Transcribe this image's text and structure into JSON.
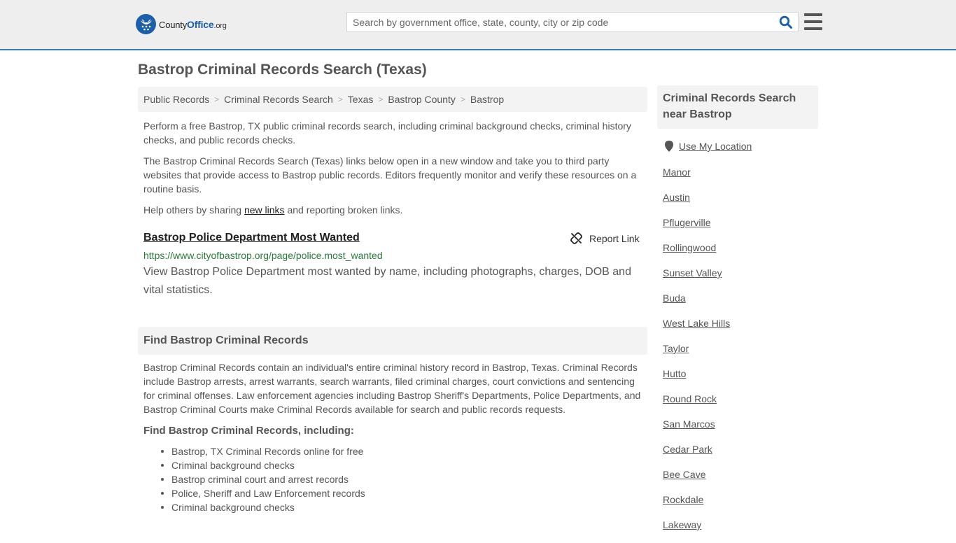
{
  "header": {
    "logo": {
      "brand_main": "County",
      "brand_accent": "Office",
      "brand_tld": ".org"
    },
    "search": {
      "placeholder": "Search by government office, state, county, city or zip code",
      "value": "",
      "icon": "search-icon"
    },
    "menu_icon": "hamburger-menu-icon"
  },
  "colors": {
    "brand_blue": "#1c5ea8",
    "header_border": "#3a7cb0",
    "url_green": "#2a7a3a",
    "panel_bg": "#f3f3f3"
  },
  "page": {
    "title": "Bastrop Criminal Records Search (Texas)",
    "breadcrumb": [
      {
        "label": "Public Records"
      },
      {
        "label": "Criminal Records Search"
      },
      {
        "label": "Texas"
      },
      {
        "label": "Bastrop County"
      },
      {
        "label": "Bastrop"
      }
    ],
    "intro": "Perform a free Bastrop, TX public criminal records search, including criminal background checks, criminal history checks, and public records checks.",
    "disclaimer": "The Bastrop Criminal Records Search (Texas) links below open in a new window and take you to third party websites that provide access to Bastrop public records. Editors frequently monitor and verify these resources on a routine basis.",
    "help": {
      "before": "Help others by sharing ",
      "link": "new links",
      "after": " and reporting broken links."
    }
  },
  "listing": {
    "title": "Bastrop Police Department Most Wanted",
    "report_label": "Report Link",
    "url": "https://www.cityofbastrop.org/page/police.most_wanted",
    "description": "View Bastrop Police Department most wanted by name, including photographs, charges, DOB and vital statistics."
  },
  "find_section": {
    "heading": "Find Bastrop Criminal Records",
    "body": "Bastrop Criminal Records contain an individual's entire criminal history record in Bastrop, Texas. Criminal Records include Bastrop arrests, arrest warrants, search warrants, filed criminal charges, court convictions and sentencing for criminal offenses. Law enforcement agencies including Bastrop Sheriff's Departments, Police Departments, and Bastrop Criminal Courts make Criminal Records available for search and public records requests.",
    "subheading": "Find Bastrop Criminal Records, including:",
    "items": [
      "Bastrop, TX Criminal Records online for free",
      "Criminal background checks",
      "Bastrop criminal court and arrest records",
      "Police, Sheriff and Law Enforcement records",
      "Criminal background checks"
    ]
  },
  "sidebar": {
    "heading": "Criminal Records Search near Bastrop",
    "use_location": "Use My Location",
    "cities": [
      "Manor",
      "Austin",
      "Pflugerville",
      "Rollingwood",
      "Sunset Valley",
      "Buda",
      "West Lake Hills",
      "Taylor",
      "Hutto",
      "Round Rock",
      "San Marcos",
      "Cedar Park",
      "Bee Cave",
      "Rockdale",
      "Lakeway"
    ]
  }
}
